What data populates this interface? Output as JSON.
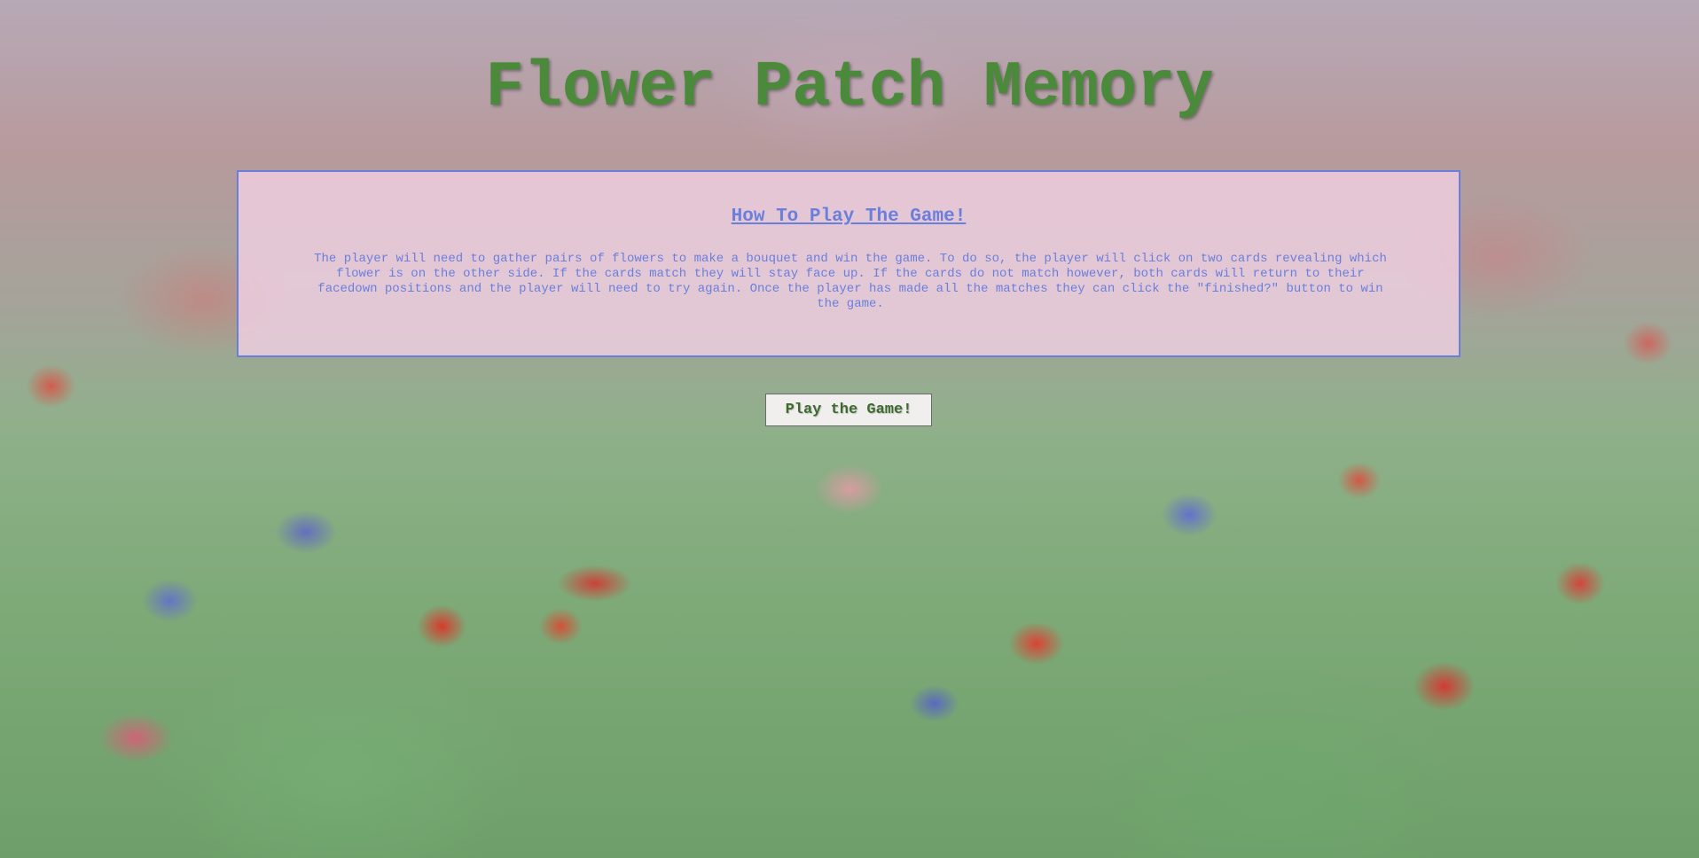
{
  "page": {
    "title": "Flower Patch Memory"
  },
  "instructions": {
    "heading": "How To Play The Game!",
    "body": "The player will need to gather pairs of flowers to make a bouquet and win the game. To do so, the player will click on two cards revealing which flower is on the other side. If the cards match they will stay face up. If the cards do not match however, both cards will return to their facedown positions and the player will need to try again. Once the player has made all the matches they can click the \"finished?\" button to win the game."
  },
  "actions": {
    "play_label": "Play the Game!"
  },
  "colors": {
    "title": "#4a8a3a",
    "panel_text": "#6a7fdc",
    "panel_border": "#6a7fdc",
    "panel_background": "#f4d2e6",
    "button_text": "#3d6b2f"
  }
}
